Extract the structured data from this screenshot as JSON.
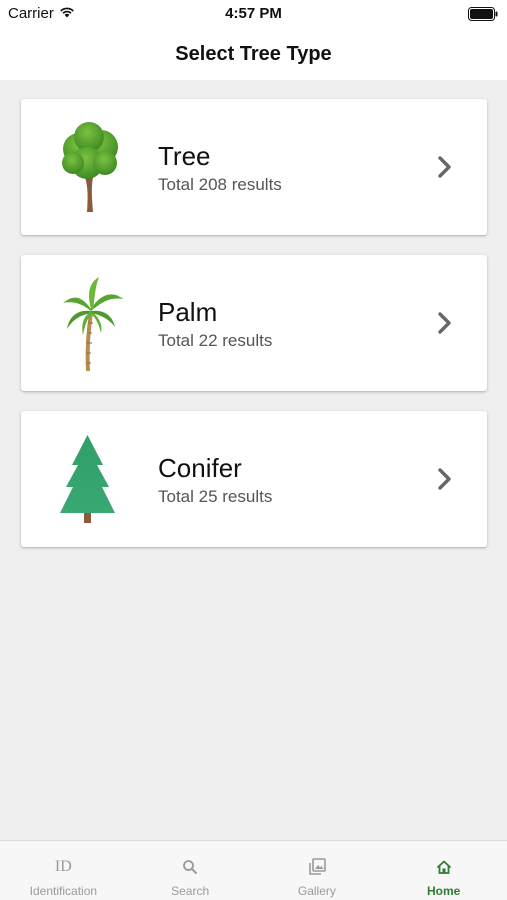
{
  "status_bar": {
    "carrier": "Carrier",
    "time": "4:57 PM"
  },
  "header": {
    "title": "Select Tree Type"
  },
  "tree_types": [
    {
      "name": "Tree",
      "count_text": "Total 208 results",
      "icon": "broadleaf-tree-icon"
    },
    {
      "name": "Palm",
      "count_text": "Total 22 results",
      "icon": "palm-tree-icon"
    },
    {
      "name": "Conifer",
      "count_text": "Total 25 results",
      "icon": "conifer-tree-icon"
    }
  ],
  "tab_bar": {
    "tabs": [
      {
        "label": "Identification",
        "icon": "id-icon",
        "glyph": "ID",
        "active": false
      },
      {
        "label": "Search",
        "icon": "search-icon",
        "active": false
      },
      {
        "label": "Gallery",
        "icon": "gallery-icon",
        "active": false
      },
      {
        "label": "Home",
        "icon": "home-icon",
        "active": true
      }
    ]
  },
  "colors": {
    "accent": "#2e7d32",
    "background": "#efefef",
    "card": "#ffffff",
    "inactive_tab": "#9a9a9a"
  }
}
